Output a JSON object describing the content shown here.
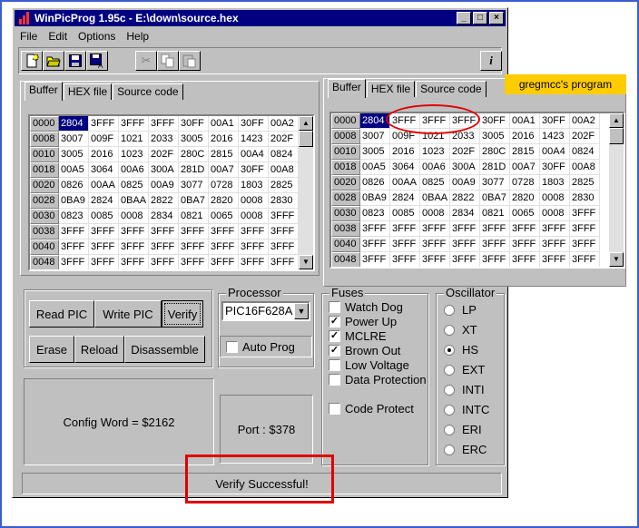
{
  "window": {
    "title": "WinPicProg 1.95c - E:\\down\\source.hex"
  },
  "menu": [
    "File",
    "Edit",
    "Options",
    "Help"
  ],
  "tabs": [
    "Buffer",
    "HEX file",
    "Source code"
  ],
  "banner": "gregmcc's program",
  "left_buffer": {
    "rows": [
      {
        "addr": "0000",
        "vals": [
          "2804",
          "3FFF",
          "3FFF",
          "3FFF",
          "30FF",
          "00A1",
          "30FF",
          "00A2"
        ]
      },
      {
        "addr": "0008",
        "vals": [
          "3007",
          "009F",
          "1021",
          "2033",
          "3005",
          "2016",
          "1423",
          "202F"
        ]
      },
      {
        "addr": "0010",
        "vals": [
          "3005",
          "2016",
          "1023",
          "202F",
          "280C",
          "2815",
          "00A4",
          "0824"
        ]
      },
      {
        "addr": "0018",
        "vals": [
          "00A5",
          "3064",
          "00A6",
          "300A",
          "281D",
          "00A7",
          "30FF",
          "00A8"
        ]
      },
      {
        "addr": "0020",
        "vals": [
          "0826",
          "00AA",
          "0825",
          "00A9",
          "3077",
          "0728",
          "1803",
          "2825"
        ]
      },
      {
        "addr": "0028",
        "vals": [
          "0BA9",
          "2824",
          "0BAA",
          "2822",
          "0BA7",
          "2820",
          "0008",
          "2830"
        ]
      },
      {
        "addr": "0030",
        "vals": [
          "0823",
          "0085",
          "0008",
          "2834",
          "0821",
          "0065",
          "0008",
          "3FFF"
        ]
      },
      {
        "addr": "0038",
        "vals": [
          "3FFF",
          "3FFF",
          "3FFF",
          "3FFF",
          "3FFF",
          "3FFF",
          "3FFF",
          "3FFF"
        ]
      },
      {
        "addr": "0040",
        "vals": [
          "3FFF",
          "3FFF",
          "3FFF",
          "3FFF",
          "3FFF",
          "3FFF",
          "3FFF",
          "3FFF"
        ]
      },
      {
        "addr": "0048",
        "vals": [
          "3FFF",
          "3FFF",
          "3FFF",
          "3FFF",
          "3FFF",
          "3FFF",
          "3FFF",
          "3FFF"
        ]
      }
    ]
  },
  "right_buffer": {
    "rows": [
      {
        "addr": "0000",
        "vals": [
          "2804",
          "3FFF",
          "3FFF",
          "3FFF",
          "30FF",
          "00A1",
          "30FF",
          "00A2"
        ]
      },
      {
        "addr": "0008",
        "vals": [
          "3007",
          "009F",
          "1021",
          "2033",
          "3005",
          "2016",
          "1423",
          "202F"
        ]
      },
      {
        "addr": "0010",
        "vals": [
          "3005",
          "2016",
          "1023",
          "202F",
          "280C",
          "2815",
          "00A4",
          "0824"
        ]
      },
      {
        "addr": "0018",
        "vals": [
          "00A5",
          "3064",
          "00A6",
          "300A",
          "281D",
          "00A7",
          "30FF",
          "00A8"
        ]
      },
      {
        "addr": "0020",
        "vals": [
          "0826",
          "00AA",
          "0825",
          "00A9",
          "3077",
          "0728",
          "1803",
          "2825"
        ]
      },
      {
        "addr": "0028",
        "vals": [
          "0BA9",
          "2824",
          "0BAA",
          "2822",
          "0BA7",
          "2820",
          "0008",
          "2830"
        ]
      },
      {
        "addr": "0030",
        "vals": [
          "0823",
          "0085",
          "0008",
          "2834",
          "0821",
          "0065",
          "0008",
          "3FFF"
        ]
      },
      {
        "addr": "0038",
        "vals": [
          "3FFF",
          "3FFF",
          "3FFF",
          "3FFF",
          "3FFF",
          "3FFF",
          "3FFF",
          "3FFF"
        ]
      },
      {
        "addr": "0040",
        "vals": [
          "3FFF",
          "3FFF",
          "3FFF",
          "3FFF",
          "3FFF",
          "3FFF",
          "3FFF",
          "3FFF"
        ]
      },
      {
        "addr": "0048",
        "vals": [
          "3FFF",
          "3FFF",
          "3FFF",
          "3FFF",
          "3FFF",
          "3FFF",
          "3FFF",
          "3FFF"
        ]
      }
    ]
  },
  "buttons": {
    "read_pic": "Read PIC",
    "write_pic": "Write PIC",
    "verify": "Verify",
    "erase": "Erase",
    "reload": "Reload",
    "disassemble": "Disassemble"
  },
  "processor": {
    "title": "Processor",
    "selected": "PIC16F628A",
    "auto_prog": "Auto Prog",
    "auto_prog_checked": false
  },
  "fuses": {
    "title": "Fuses",
    "items": [
      {
        "label": "Watch Dog",
        "checked": false
      },
      {
        "label": "Power Up",
        "checked": true
      },
      {
        "label": "MCLRE",
        "checked": true
      },
      {
        "label": "Brown Out",
        "checked": true
      },
      {
        "label": "Low Voltage",
        "checked": false
      },
      {
        "label": "Data Protection",
        "checked": false
      }
    ],
    "code_protect": {
      "label": "Code Protect",
      "checked": false
    }
  },
  "oscillator": {
    "title": "Oscillator",
    "options": [
      "LP",
      "XT",
      "HS",
      "EXT",
      "INTI",
      "INTC",
      "ERI",
      "ERC"
    ],
    "selected": "HS"
  },
  "config_word": "Config Word = $2162",
  "port": "Port : $378",
  "status": "Verify Successful!",
  "colors": {
    "title_bar": "#000080",
    "selection": "#000080",
    "face": "#c0c0c0",
    "banner": "#ffcc00",
    "annotation": "#e00000",
    "frame": "#3a5fcd"
  }
}
